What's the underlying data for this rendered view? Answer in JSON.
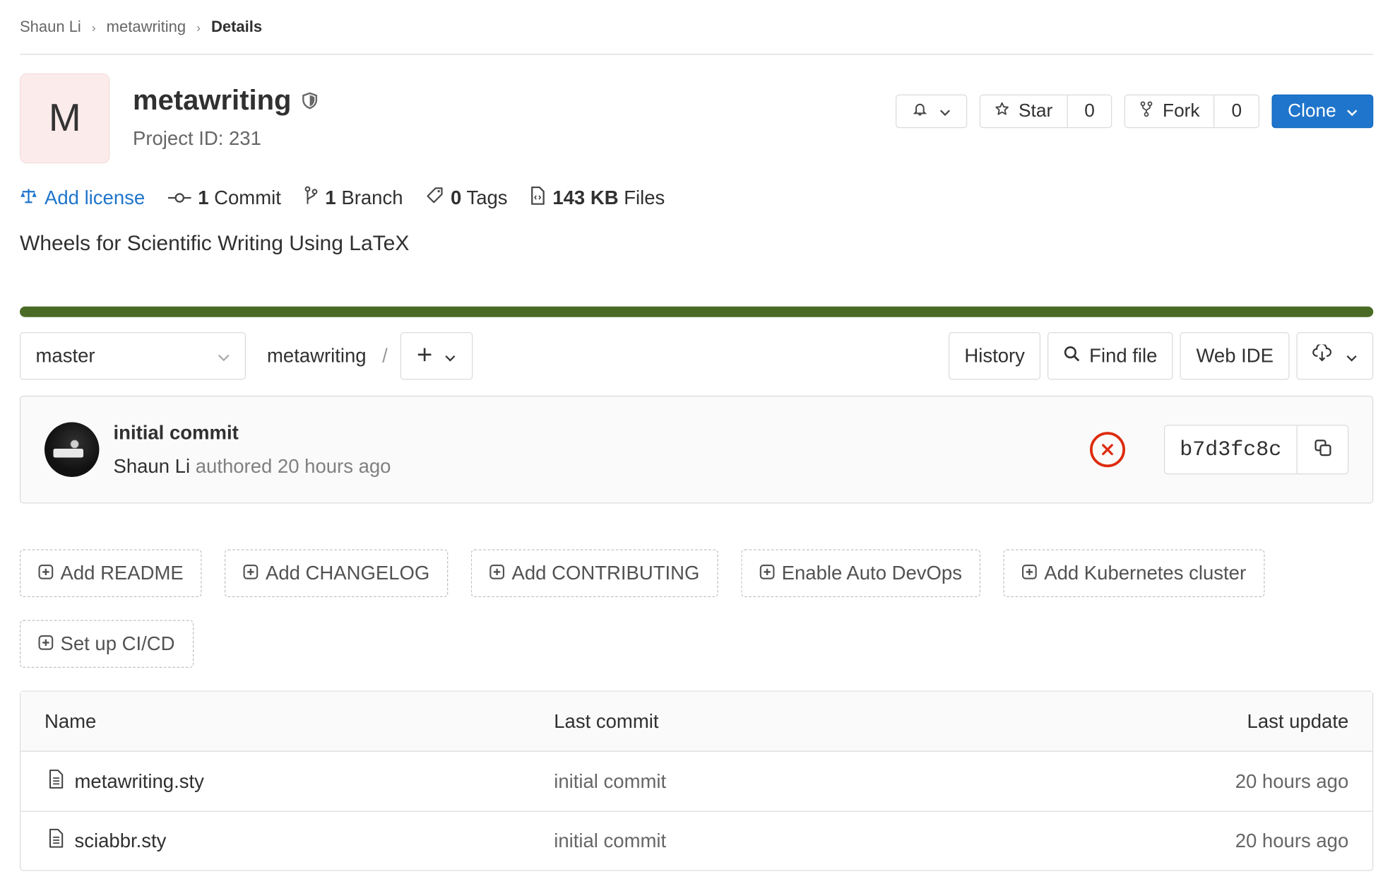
{
  "breadcrumb": {
    "items": [
      "Shaun Li",
      "metawriting"
    ],
    "current": "Details"
  },
  "project": {
    "avatar_letter": "M",
    "name": "metawriting",
    "id_label": "Project ID: 231",
    "description": "Wheels for Scientific Writing Using LaTeX"
  },
  "actions": {
    "star_label": "Star",
    "star_count": "0",
    "fork_label": "Fork",
    "fork_count": "0",
    "clone_label": "Clone"
  },
  "stats": {
    "license": "Add license",
    "commits_count": "1",
    "commits_label": "Commit",
    "branches_count": "1",
    "branches_label": "Branch",
    "tags_count": "0",
    "tags_label": "Tags",
    "files_size": "143 KB",
    "files_label": "Files"
  },
  "language_bar_color": "#4a6b25",
  "toolbar": {
    "branch": "master",
    "path_root": "metawriting",
    "path_sep": "/",
    "history": "History",
    "find_file": "Find file",
    "web_ide": "Web IDE"
  },
  "last_commit": {
    "title": "initial commit",
    "author": "Shaun Li",
    "authored_text": "authored 20 hours ago",
    "sha": "b7d3fc8c",
    "status": "failed"
  },
  "suggestions": [
    "Add README",
    "Add CHANGELOG",
    "Add CONTRIBUTING",
    "Enable Auto DevOps",
    "Add Kubernetes cluster",
    "Set up CI/CD"
  ],
  "file_table": {
    "headers": [
      "Name",
      "Last commit",
      "Last update"
    ],
    "rows": [
      {
        "name": "metawriting.sty",
        "commit": "initial commit",
        "updated": "20 hours ago"
      },
      {
        "name": "sciabbr.sty",
        "commit": "initial commit",
        "updated": "20 hours ago"
      }
    ]
  },
  "colors": {
    "primary": "#1f75cb",
    "danger": "#dd2b0e",
    "avatar_bg": "#fcebeb"
  }
}
